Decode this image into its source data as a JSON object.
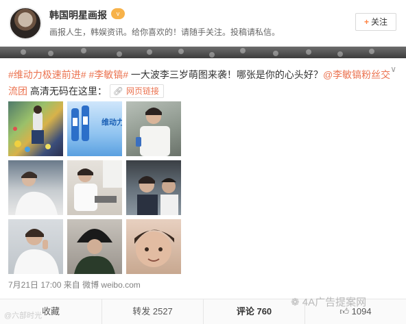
{
  "account": {
    "name": "韩国明星画报",
    "badge": "v",
    "description": "画报人生，韩娱资讯。给你喜欢的！请随手关注。投稿请私信。",
    "follow_label": "关注",
    "follow_icon": "+"
  },
  "post": {
    "menu_icon": "chevron-down",
    "tag1": "#维动力极速前进#",
    "tag2": "#李敏镐#",
    "text_main": " 一大波李三岁萌图来袭！哪张是你的心头好？",
    "mention": "@李敏镐粉丝交流团",
    "text_tail": " 高清无码在这里：",
    "link_label": "网页链接",
    "timestamp": "7月21日 17:00",
    "source_prefix": "来自",
    "source": "微博 weibo.com"
  },
  "thumbnails": [
    {
      "alt": "photo-1"
    },
    {
      "alt": "photo-2",
      "overlay_text": "维动力 全新动"
    },
    {
      "alt": "photo-3"
    },
    {
      "alt": "photo-4"
    },
    {
      "alt": "photo-5"
    },
    {
      "alt": "photo-6"
    },
    {
      "alt": "photo-7"
    },
    {
      "alt": "photo-8"
    },
    {
      "alt": "photo-9"
    }
  ],
  "actions": {
    "favorite_label": "收藏",
    "repost_label": "转发",
    "repost_count": "2527",
    "comment_label": "评论",
    "comment_count": "760",
    "like_count": "1094"
  },
  "watermarks": {
    "left": "@六部时光",
    "right": "4A广告提案网"
  }
}
